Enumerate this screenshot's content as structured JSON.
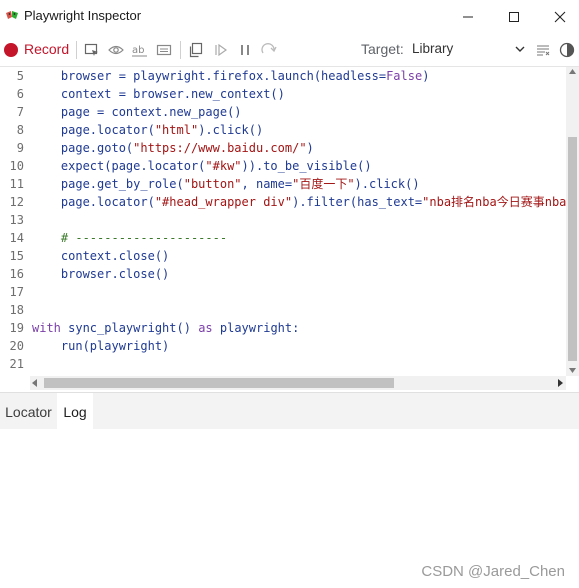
{
  "window": {
    "title": "Playwright Inspector",
    "icons": {
      "app": "playwright-logo-icon",
      "minimize": "minimize-icon",
      "maximize": "maximize-icon",
      "close": "close-icon"
    }
  },
  "toolbar": {
    "record_label": "Record",
    "record_color": "#c4152b",
    "icons": [
      "pick-locator-icon",
      "assert-visibility-icon",
      "assert-text-icon",
      "assert-value-icon",
      "copy-icon",
      "resume-icon",
      "pause-icon",
      "step-over-icon"
    ],
    "target_label": "Target:",
    "target_value": "Library",
    "right_icons": [
      "clear-icon",
      "toggle-theme-icon"
    ]
  },
  "editor": {
    "lines": [
      {
        "n": "5",
        "code": "    browser = playwright.firefox.launch(headless=False)"
      },
      {
        "n": "6",
        "code": "    context = browser.new_context()"
      },
      {
        "n": "7",
        "code": "    page = context.new_page()"
      },
      {
        "n": "8",
        "code": "    page.locator(\"html\").click()"
      },
      {
        "n": "9",
        "code": "    page.goto(\"https://www.baidu.com/\")"
      },
      {
        "n": "10",
        "code": "    expect(page.locator(\"#kw\")).to_be_visible()"
      },
      {
        "n": "11",
        "code": "    page.get_by_role(\"button\", name=\"百度一下\").click()"
      },
      {
        "n": "12",
        "code": "    page.locator(\"#head_wrapper div\").filter(has_text=\"nba排名nba今日赛事nba"
      },
      {
        "n": "13",
        "code": ""
      },
      {
        "n": "14",
        "code": "    # ---------------------"
      },
      {
        "n": "15",
        "code": "    context.close()"
      },
      {
        "n": "16",
        "code": "    browser.close()"
      },
      {
        "n": "17",
        "code": ""
      },
      {
        "n": "18",
        "code": ""
      },
      {
        "n": "19",
        "code": "with sync_playwright() as playwright:"
      },
      {
        "n": "20",
        "code": "    run(playwright)"
      },
      {
        "n": "21",
        "code": ""
      }
    ]
  },
  "tabs": [
    {
      "label": "Locator",
      "active": false
    },
    {
      "label": "Log",
      "active": true
    }
  ],
  "watermark": "CSDN @Jared_Chen"
}
